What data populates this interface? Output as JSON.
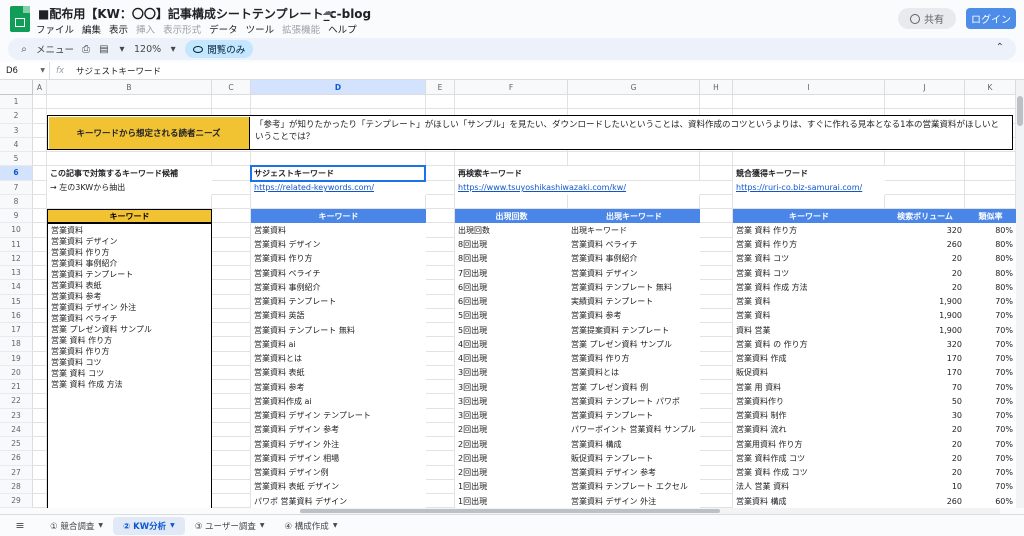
{
  "window": {
    "title": "■配布用【KW：〇〇】記事構成シートテンプレート_c-blog",
    "share_label": "共有",
    "login_label": "ログイン"
  },
  "menu": [
    "ファイル",
    "編集",
    "表示",
    "挿入",
    "表示形式",
    "データ",
    "ツール",
    "拡張機能",
    "ヘルプ"
  ],
  "menu_disabled": [
    false,
    false,
    false,
    true,
    true,
    false,
    false,
    true,
    false
  ],
  "toolbar": {
    "search_label": "メニュー",
    "zoom": "120%",
    "view_only_label": "閲覧のみ"
  },
  "formula": {
    "namebox": "D6",
    "fx": "fx",
    "content": "サジェストキーワード"
  },
  "columns": [
    "A",
    "B",
    "C",
    "D",
    "E",
    "F",
    "G",
    "H",
    "I",
    "J",
    "K"
  ],
  "selected_column": "D",
  "selected_row": "6",
  "rows": [
    "1",
    "2",
    "3",
    "4",
    "5",
    "6",
    "7",
    "8",
    "9",
    "10",
    "11",
    "12",
    "13",
    "14",
    "15",
    "16",
    "17",
    "18",
    "19",
    "20",
    "21",
    "22",
    "23",
    "24",
    "25",
    "26",
    "27",
    "28",
    "29"
  ],
  "needs": {
    "label": "キーワードから想定される読者ニーズ",
    "text": "「参考」が知りたかったり「テンプレート」がほしい「サンプル」を見たい、ダウンロードしたいということは、資料作成のコツというよりは、すぐに作れる見本となる1本の営業資料がほしいということでは？"
  },
  "sections": {
    "target_title": "この記事で対策するキーワード候補",
    "target_note": "→ 左の3KWから抽出",
    "suggest_title": "サジェストキーワード",
    "suggest_url": "https://related-keywords.com/",
    "research_title": "再検索キーワード",
    "research_url": "https://www.tsuyoshikashiwazaki.com/kw/",
    "competitor_title": "競合獲得キーワード",
    "competitor_url": "https://ruri-co.biz-samurai.com/"
  },
  "headers": {
    "keyword_b": "キーワード",
    "keyword_d": "キーワード",
    "count_f": "出現回数",
    "kw_g": "出現キーワード",
    "keyword_i": "キーワード",
    "volume_j": "検索ボリューム",
    "similarity_k": "類似率"
  },
  "target_keywords": [
    "営業資料",
    "営業資料 デザイン",
    "営業資料 作り方",
    "営業資料 事例紹介",
    "営業資料 テンプレート",
    "営業資料 表紙",
    "営業資料 参考",
    "営業資料 デザイン 外注",
    "営業資料 ペライチ",
    "営業 プレゼン資料 サンプル",
    "営業 資料 作り方",
    "営業資料 作り方",
    "営業資料 コツ",
    "営業 資料 コツ",
    "営業 資料 作成 方法"
  ],
  "suggest_keywords": [
    "営業資料",
    "営業資料 デザイン",
    "営業資料 作り方",
    "営業資料 ペライチ",
    "営業資料 事例紹介",
    "営業資料 テンプレート",
    "営業資料 英語",
    "営業資料 テンプレート 無料",
    "営業資料 ai",
    "営業資料とは",
    "営業資料 表紙",
    "営業資料 参考",
    "営業資料作成 ai",
    "営業資料 デザイン テンプレート",
    "営業資料 デザイン 参考",
    "営業資料 デザイン 外注",
    "営業資料 デザイン 相場",
    "営業資料 デザイン例",
    "営業資料 表紙 デザイン",
    "パワポ 営業資料 デザイン"
  ],
  "research_rows": [
    [
      "出現回数",
      "出現キーワード"
    ],
    [
      "8回出現",
      "営業資料 ペライチ"
    ],
    [
      "8回出現",
      "営業資料 事例紹介"
    ],
    [
      "7回出現",
      "営業資料 デザイン"
    ],
    [
      "6回出現",
      "営業資料 テンプレート 無料"
    ],
    [
      "6回出現",
      "実績資料 テンプレート"
    ],
    [
      "5回出現",
      "営業資料 参考"
    ],
    [
      "5回出現",
      "営業提案資料 テンプレート"
    ],
    [
      "4回出現",
      "営業 プレゼン資料 サンプル"
    ],
    [
      "4回出現",
      "営業資料 作り方"
    ],
    [
      "3回出現",
      "営業資料とは"
    ],
    [
      "3回出現",
      "営業 プレゼン資料 例"
    ],
    [
      "3回出現",
      "営業資料 テンプレート パワポ"
    ],
    [
      "3回出現",
      "営業資料 テンプレート"
    ],
    [
      "2回出現",
      "パワーポイント 営業資料 サンプル"
    ],
    [
      "2回出現",
      "営業資料 構成"
    ],
    [
      "2回出現",
      "販促資料 テンプレート"
    ],
    [
      "2回出現",
      "営業資料 デザイン 参考"
    ],
    [
      "1回出現",
      "営業資料 テンプレート エクセル"
    ],
    [
      "1回出現",
      "営業資料 デザイン 外注"
    ]
  ],
  "competitor_rows": [
    [
      "営業 資料 作り方",
      "320",
      "80%"
    ],
    [
      "営業 資料 作り方",
      "260",
      "80%"
    ],
    [
      "営業 資料 コツ",
      "20",
      "80%"
    ],
    [
      "営業 資料 コツ",
      "20",
      "80%"
    ],
    [
      "営業 資料 作成 方法",
      "20",
      "80%"
    ],
    [
      "営業 資料",
      "1,900",
      "70%"
    ],
    [
      "営業 資料",
      "1,900",
      "70%"
    ],
    [
      "資料 営業",
      "1,900",
      "70%"
    ],
    [
      "営業 資料 の 作り方",
      "320",
      "70%"
    ],
    [
      "営業資料 作成",
      "170",
      "70%"
    ],
    [
      "販促資料",
      "170",
      "70%"
    ],
    [
      "営業 用 資料",
      "70",
      "70%"
    ],
    [
      "営業資料作り",
      "50",
      "70%"
    ],
    [
      "営業資料 制作",
      "30",
      "70%"
    ],
    [
      "営業資料 流れ",
      "20",
      "70%"
    ],
    [
      "営業用資料 作り方",
      "20",
      "70%"
    ],
    [
      "営業 資料作成 コツ",
      "20",
      "70%"
    ],
    [
      "営業 資料 作成 コツ",
      "20",
      "70%"
    ],
    [
      "法人 営業 資料",
      "10",
      "70%"
    ],
    [
      "営業資料 構成",
      "260",
      "60%"
    ]
  ],
  "tabs": [
    {
      "label": "① 競合調査",
      "active": false
    },
    {
      "label": "② KW分析",
      "active": true
    },
    {
      "label": "③ ユーザー調査",
      "active": false
    },
    {
      "label": "④ 構成作成",
      "active": false
    }
  ],
  "colors": {
    "header_blue": "#4a86e8",
    "header_orange": "#f1c232",
    "link": "#1155cc",
    "selection": "#1a73e8"
  }
}
